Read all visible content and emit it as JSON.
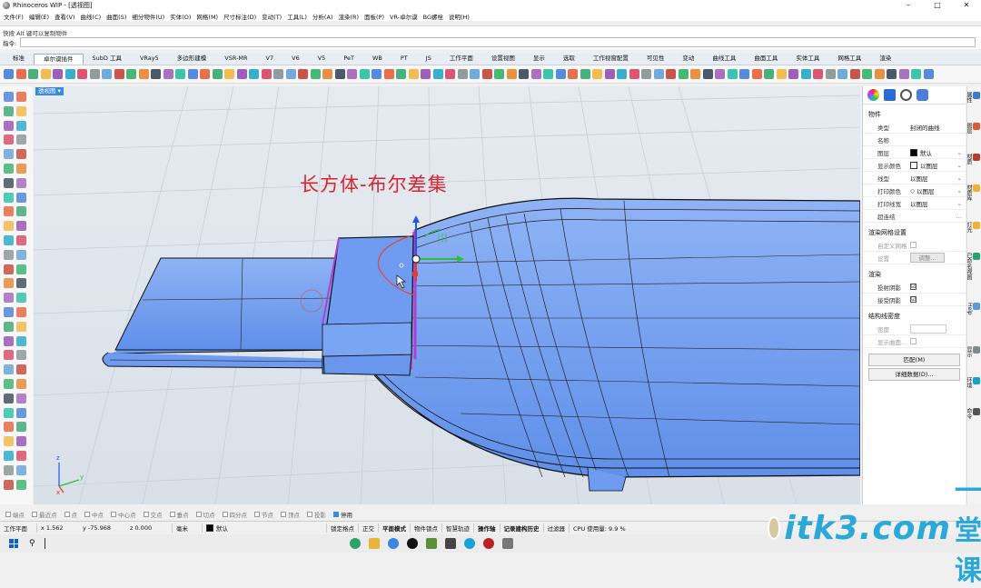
{
  "window": {
    "title": "Rhinoceros WIP - [透视图]",
    "controls": [
      "–",
      "□",
      "✕"
    ]
  },
  "menu": [
    "文件(F)",
    "编辑(E)",
    "查看(V)",
    "曲线(C)",
    "曲面(S)",
    "细分物件(U)",
    "实体(O)",
    "网格(M)",
    "尺寸标注(D)",
    "变动(T)",
    "工具(L)",
    "分析(A)",
    "渲染(R)",
    "面板(P)",
    "VR-卓尔谟",
    "BG螺栓",
    "说明(H)"
  ],
  "command": {
    "history": "快按 Alt 键可以复制物件",
    "prompt": "指令:",
    "value": ""
  },
  "tabs": [
    "标准",
    "卓尔谟插件",
    "SubD 工具",
    "VRay5",
    "多边形建模",
    "VSR-MR",
    "V7",
    "V6",
    "V5",
    "PeT",
    "WB",
    "PT",
    "JS",
    "工作平面",
    "设置视图",
    "显示",
    "选取",
    "工作视窗配置",
    "可见性",
    "变动",
    "曲线工具",
    "曲面工具",
    "实体工具",
    "网格工具",
    "渲染"
  ],
  "active_tab": "卓尔谟插件",
  "viewport": {
    "label": "透视图 ▾",
    "overlay_text": "长方体-布尔差集",
    "axis": {
      "z": "z",
      "y": "y",
      "x": "x"
    }
  },
  "properties": {
    "section_object": "物件",
    "rows": [
      {
        "key": "类型",
        "value": "封闭的曲线"
      },
      {
        "key": "名称",
        "value": ""
      },
      {
        "key": "图层",
        "value": "默认"
      },
      {
        "key": "显示颜色",
        "value": "以图层"
      },
      {
        "key": "线型",
        "value": "以图层"
      },
      {
        "key": "打印颜色",
        "value": "以图层"
      },
      {
        "key": "打印线宽",
        "value": "以图层"
      },
      {
        "key": "超连结",
        "value": ""
      }
    ],
    "section_mesh": "渲染网格设置",
    "mesh_rows": [
      {
        "key": "自定义网格",
        "value": ""
      },
      {
        "key": "设置",
        "value": "调整..."
      }
    ],
    "section_render": "渲染",
    "render_rows": [
      {
        "key": "投射阴影",
        "value": "☑"
      },
      {
        "key": "接受阴影",
        "value": "☑"
      }
    ],
    "section_iso": "结构线密度",
    "iso_rows": [
      {
        "key": "密度",
        "value": ""
      },
      {
        "key": "显示曲面...",
        "value": ""
      }
    ],
    "match_button": "匹配(M)",
    "details_button": "详细数据(D)..."
  },
  "side_tabs": [
    "属性",
    "图层",
    "材质",
    "材质库",
    "灯光",
    "已命名视图",
    "Help",
    "显示",
    "环境",
    "命令"
  ],
  "osnap": [
    "端点",
    "最近点",
    "点",
    "中点",
    "中心点",
    "交点",
    "垂点",
    "切点",
    "四分点",
    "节点",
    "顶点",
    "投影",
    "停用"
  ],
  "osnap_checked": [
    "停用"
  ],
  "status": {
    "cplane": "工作平面",
    "x": "x 1.562",
    "y": "y -75.968",
    "z": "z 0.000",
    "units": "毫米",
    "layer": "默认",
    "toggles": [
      "锁定格点",
      "正交",
      "平面模式",
      "物件锁点",
      "智慧轨迹",
      "操作轴",
      "记录建构历史",
      "过滤器"
    ],
    "cpu": "CPU 使用量: 9.9 %"
  },
  "watermark": {
    "brand": "itk3.com",
    "tagline": "一堂课"
  },
  "colors": {
    "accent": "#3d8ad9",
    "model_blue": "#6f9cf0",
    "title_red": "#d4252f",
    "watermark": "#2aa8d8"
  }
}
